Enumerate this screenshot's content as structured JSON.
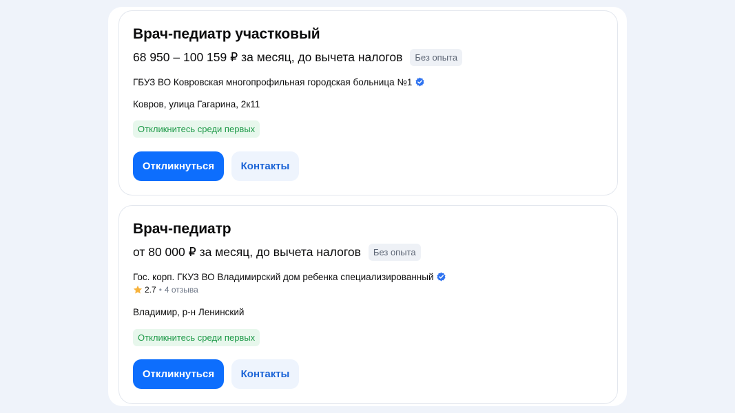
{
  "vacancies": [
    {
      "title": "Врач-педиатр участковый",
      "salary": "68 950 – 100 159 ₽ за месяц, до вычета налогов",
      "experience": "Без опыта",
      "employer": "ГБУЗ ВО Ковровская многопрофильная городская больница №1",
      "address": "Ковров, улица Гагарина, 2к11",
      "badge": "Откликнитесь среди первых",
      "apply_label": "Откликнуться",
      "contacts_label": "Контакты"
    },
    {
      "title": "Врач-педиатр",
      "salary": "от 80 000 ₽ за месяц, до вычета налогов",
      "experience": "Без опыта",
      "employer": "Гос. корп. ГКУЗ ВО Владимирский дом ребенка специализированный",
      "rating": "2.7",
      "reviews": "4 отзыва",
      "address": "Владимир, р-н Ленинский",
      "badge": "Откликнитесь среди первых",
      "apply_label": "Откликнуться",
      "contacts_label": "Контакты"
    }
  ],
  "colors": {
    "page_bg": "#eff3fa",
    "primary": "#0d6efd",
    "secondary_bg": "#eef4fd",
    "secondary_text": "#1a63d6",
    "badge_green_bg": "#e7f7ec",
    "badge_green_text": "#1f9a49",
    "verified": "#2f73f0",
    "star": "#f7b23b"
  },
  "icons": {
    "verified": "verified-check-icon",
    "rating": "star-icon"
  }
}
